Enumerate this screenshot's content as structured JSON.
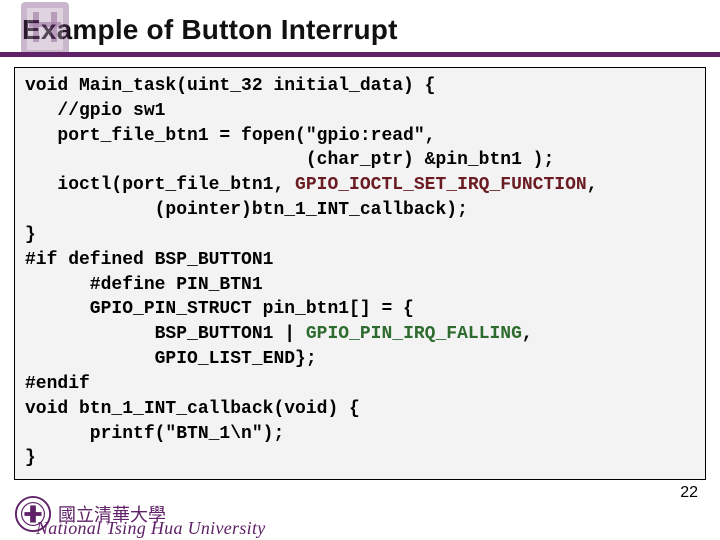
{
  "title": "Example of Button Interrupt",
  "code": {
    "l1": "void Main_task(uint_32 initial_data) {",
    "l2": "   //gpio sw1",
    "l3": "   port_file_btn1 = fopen(\"gpio:read\",",
    "l4": "                          (char_ptr) &pin_btn1 );",
    "l5a": "   ioctl(port_file_btn1, ",
    "l5b": "GPIO_IOCTL_SET_IRQ_FUNCTION",
    "l5c": ",",
    "l6": "            (pointer)btn_1_INT_callback);",
    "l7": "}",
    "l8": "#if defined BSP_BUTTON1",
    "l9": "      #define PIN_BTN1",
    "l10": "      GPIO_PIN_STRUCT pin_btn1[] = {",
    "l11a": "            BSP_BUTTON1 | ",
    "l11b": "GPIO_PIN_IRQ_FALLING",
    "l11c": ",",
    "l12": "            GPIO_LIST_END};",
    "l13": "#endif",
    "l14": "void btn_1_INT_callback(void) {",
    "l15": "      printf(\"BTN_1\\n\");",
    "l16": "}"
  },
  "footer": {
    "cn_name": "國立清華大學",
    "en_name": "National Tsing Hua University"
  },
  "page_number": "22",
  "colors": {
    "accent": "#5F2167",
    "code_bg": "#f3f3f3",
    "emphasis": "#6b1b22",
    "constant": "#2e6b2e"
  }
}
